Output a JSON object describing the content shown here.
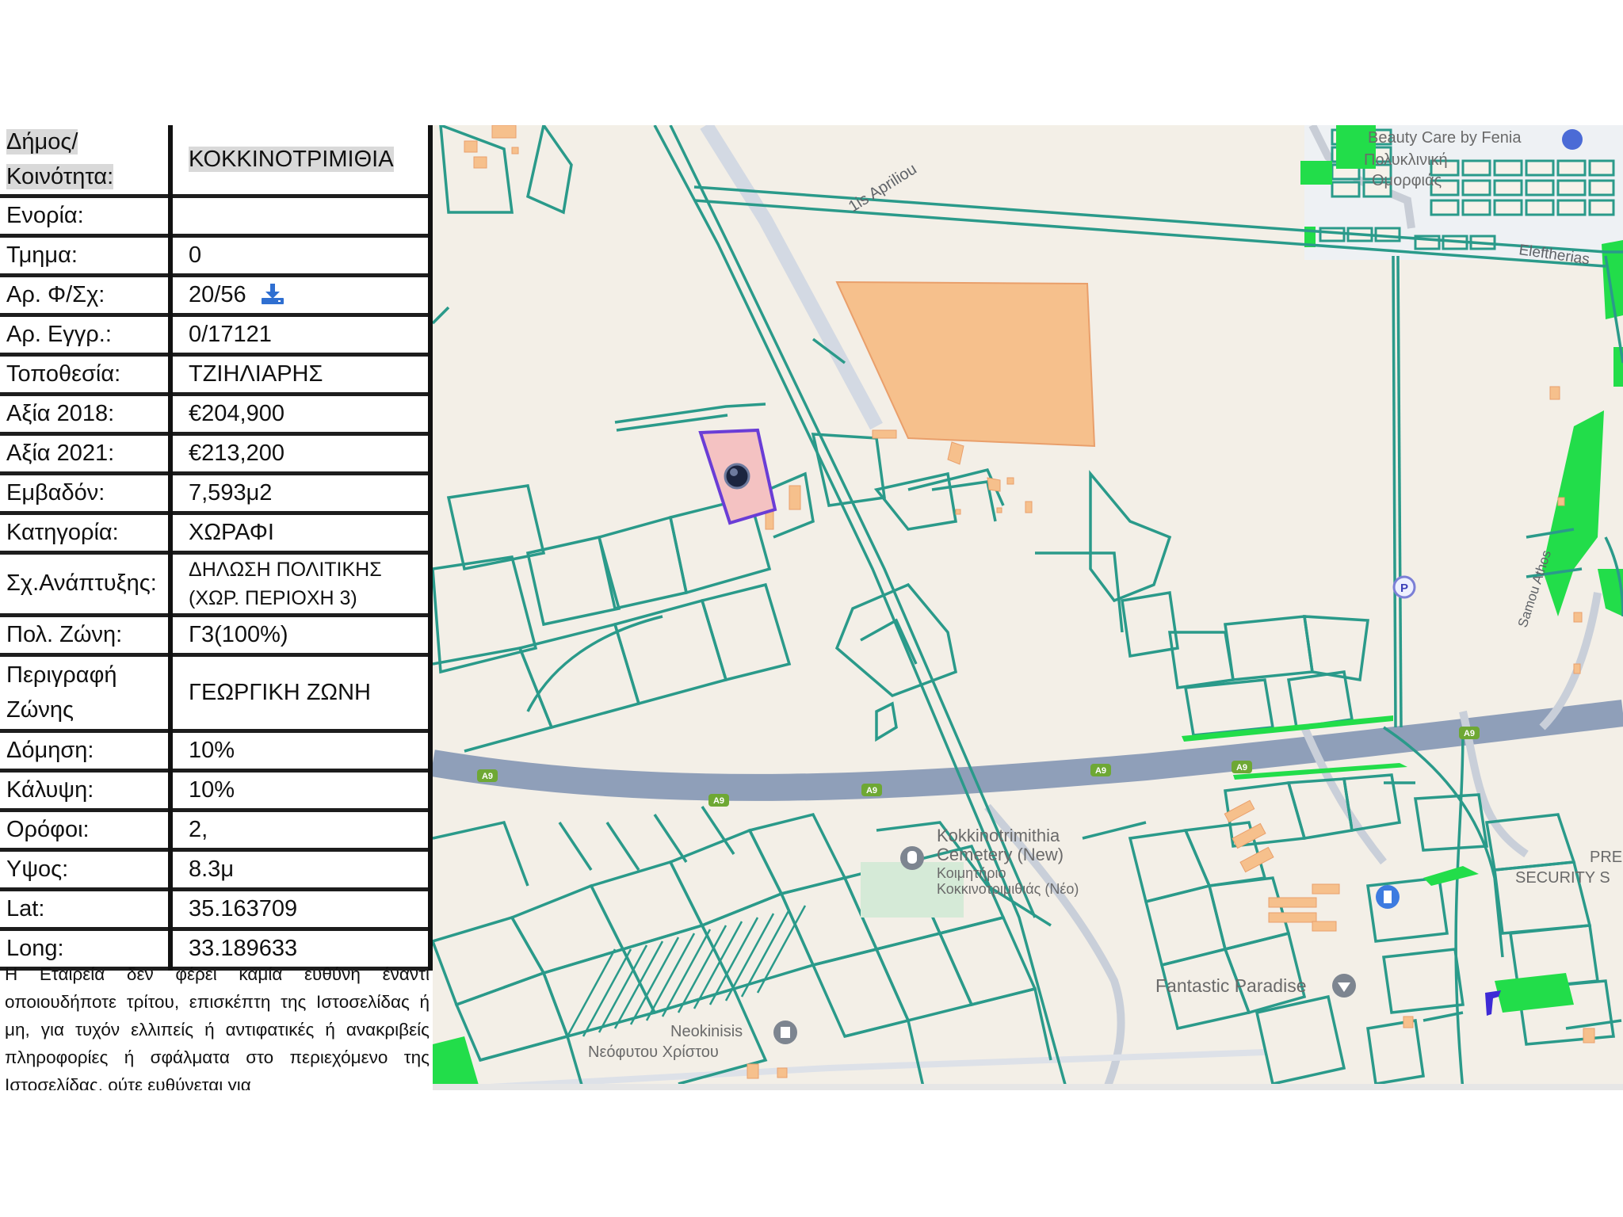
{
  "parcel_info": {
    "rows": [
      {
        "label": "Δήμος/ Κοινότητα:",
        "value": "ΚΟΚΚΙΝΟΤΡΙΜΙΘΙΑ"
      },
      {
        "label": "Ενορία:",
        "value": ""
      },
      {
        "label": "Τμημα:",
        "value": "0"
      },
      {
        "label": "Αρ. Φ/Σχ:",
        "value": "20/56"
      },
      {
        "label": "Αρ. Εγγρ.:",
        "value": "0/17121"
      },
      {
        "label": "Τοποθεσία:",
        "value": "ΤΖΙΗΛΙΑΡΗΣ"
      },
      {
        "label": "Αξία 2018:",
        "value": "€204,900"
      },
      {
        "label": "Αξία 2021:",
        "value": "€213,200"
      },
      {
        "label": "Εμβαδόν:",
        "value": "7,593μ2"
      },
      {
        "label": "Κατηγορία:",
        "value": "ΧΩΡΑΦΙ"
      },
      {
        "label": "Σχ.Ανάπτυξης:",
        "value": "ΔΗΛΩΣΗ ΠΟΛΙΤΙΚΗΣ (ΧΩΡ. ΠΕΡΙΟΧΗ 3)"
      },
      {
        "label": "Πολ. Ζώνη:",
        "value": "Γ3(100%)"
      },
      {
        "label": "Περιγραφή Ζώνης",
        "value": "ΓΕΩΡΓΙΚΗ ΖΩΝΗ"
      },
      {
        "label": "Δόμηση:",
        "value": "10%"
      },
      {
        "label": "Κάλυψη:",
        "value": "10%"
      },
      {
        "label": "Ορόφοι:",
        "value": "2,"
      },
      {
        "label": "Υψος:",
        "value": "8.3μ"
      },
      {
        "label": "Lat:",
        "value": "35.163709"
      },
      {
        "label": "Long:",
        "value": "33.189633"
      }
    ],
    "download_icon": "download-icon",
    "disclaimer": "Η Εταιρεία δεν φέρει καμία ευθύνη έναντι οποιουδήποτε τρίτου, επισκέπτη της Ιστοσελίδας ή μη, για τυχόν ελλιπείς ή αντιφατικές ή ανακριβείς πληροφορίες ή σφάλματα στο περιεχόμενο της Ιστοσελίδας, ούτε ευθύνεται για"
  },
  "map": {
    "roads": {
      "highway": "A9",
      "street_1": "1is Apriliou",
      "street_2": "Eleftherias",
      "street_3": "Samou Athos"
    },
    "labels": {
      "beauty_1": "Beauty Care by Fenia",
      "beauty_2": "Πολυκλινική",
      "beauty_3": "Ομορφιάς",
      "cemetery_1": "Kokkinotrimithia",
      "cemetery_2": "Cemetery (New)",
      "cemetery_3": "Κοιμητήριο",
      "cemetery_4": "Κοκκινοτριμιθιάς (Νέο)",
      "fantastic": "Fantastic Paradise",
      "neokinisis_1": "Neokinisis",
      "neokinisis_2": "Νεόφυτου Χρίστου",
      "security_1": "PRE",
      "security_2": "SECURITY S"
    },
    "icons": [
      "location-marker-icon",
      "parking-icon",
      "cemetery-icon",
      "shop-icon",
      "landmark-icon",
      "pharmacy-icon"
    ],
    "colors": {
      "background": "#f3efe7",
      "parcel_lines": "#2a9a8a",
      "green_area": "#22dd4a",
      "selected_parcel_fill": "#f4c2c2",
      "selected_parcel_border": "#6a3dd6",
      "highway": "#8f9fb9",
      "building": "#f6c08c"
    }
  }
}
